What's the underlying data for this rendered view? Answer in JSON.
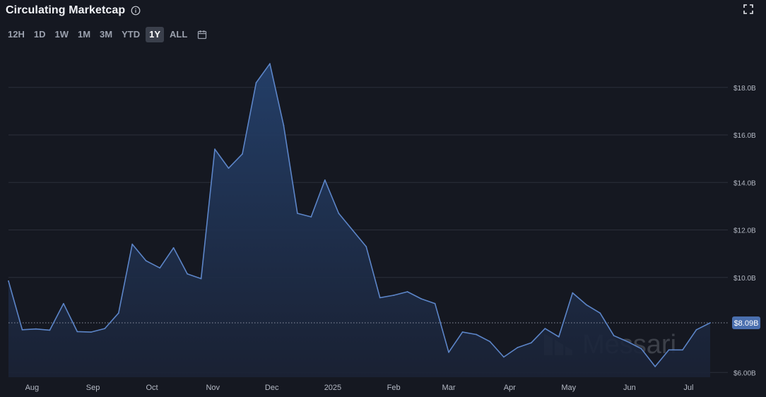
{
  "header": {
    "title": "Circulating Marketcap",
    "ranges": [
      "12H",
      "1D",
      "1W",
      "1M",
      "3M",
      "YTD",
      "1Y",
      "ALL"
    ],
    "active_range": "1Y"
  },
  "icons": {
    "info": "info-icon",
    "calendar": "calendar-icon",
    "expand": "fullscreen-icon"
  },
  "colors": {
    "background": "#151821",
    "line": "#5c85c8",
    "area_top": "#24406b",
    "area_bottom": "#1a2235",
    "grid": "#2b2f3a",
    "label_badge": "#4a6fae"
  },
  "watermark": "Messari",
  "chart_data": {
    "type": "area",
    "title": "Circulating Marketcap",
    "ylim": [
      5.8,
      19.6
    ],
    "y_ticks": [
      6,
      10,
      12,
      14,
      16,
      18
    ],
    "y_tick_labels": [
      "$6.00B",
      "$10.0B",
      "$12.0B",
      "$14.0B",
      "$16.0B",
      "$18.0B"
    ],
    "x_range": [
      "2024-07-20",
      "2025-07-21"
    ],
    "x_ticks": [
      {
        "date": "2024-08-01",
        "label": "Aug"
      },
      {
        "date": "2024-09-01",
        "label": "Sep"
      },
      {
        "date": "2024-10-01",
        "label": "Oct"
      },
      {
        "date": "2024-11-01",
        "label": "Nov"
      },
      {
        "date": "2024-12-01",
        "label": "Dec"
      },
      {
        "date": "2025-01-01",
        "label": "2025"
      },
      {
        "date": "2025-02-01",
        "label": "Feb"
      },
      {
        "date": "2025-03-01",
        "label": "Mar"
      },
      {
        "date": "2025-04-01",
        "label": "Apr"
      },
      {
        "date": "2025-05-01",
        "label": "May"
      },
      {
        "date": "2025-06-01",
        "label": "Jun"
      },
      {
        "date": "2025-07-01",
        "label": "Jul"
      }
    ],
    "series": [
      {
        "points": [
          [
            "2024-07-20",
            9.85
          ],
          [
            "2024-07-27",
            7.8
          ],
          [
            "2024-08-03",
            7.83
          ],
          [
            "2024-08-10",
            7.78
          ],
          [
            "2024-08-17",
            8.9
          ],
          [
            "2024-08-24",
            7.72
          ],
          [
            "2024-08-31",
            7.7
          ],
          [
            "2024-09-07",
            7.85
          ],
          [
            "2024-09-14",
            8.5
          ],
          [
            "2024-09-21",
            11.4
          ],
          [
            "2024-09-28",
            10.7
          ],
          [
            "2024-10-05",
            10.4
          ],
          [
            "2024-10-12",
            11.25
          ],
          [
            "2024-10-19",
            10.15
          ],
          [
            "2024-10-26",
            9.95
          ],
          [
            "2024-11-02",
            15.4
          ],
          [
            "2024-11-09",
            14.6
          ],
          [
            "2024-11-16",
            15.2
          ],
          [
            "2024-11-23",
            18.2
          ],
          [
            "2024-11-30",
            19.0
          ],
          [
            "2024-12-07",
            16.4
          ],
          [
            "2024-12-14",
            12.7
          ],
          [
            "2024-12-21",
            12.55
          ],
          [
            "2024-12-28",
            14.1
          ],
          [
            "2025-01-04",
            12.7
          ],
          [
            "2025-01-11",
            12.0
          ],
          [
            "2025-01-18",
            11.3
          ],
          [
            "2025-01-25",
            9.15
          ],
          [
            "2025-02-01",
            9.25
          ],
          [
            "2025-02-08",
            9.4
          ],
          [
            "2025-02-15",
            9.1
          ],
          [
            "2025-02-22",
            8.9
          ],
          [
            "2025-03-01",
            6.85
          ],
          [
            "2025-03-08",
            7.7
          ],
          [
            "2025-03-15",
            7.6
          ],
          [
            "2025-03-22",
            7.3
          ],
          [
            "2025-03-29",
            6.65
          ],
          [
            "2025-04-05",
            7.05
          ],
          [
            "2025-04-12",
            7.25
          ],
          [
            "2025-04-19",
            7.85
          ],
          [
            "2025-04-26",
            7.5
          ],
          [
            "2025-05-03",
            9.35
          ],
          [
            "2025-05-10",
            8.85
          ],
          [
            "2025-05-17",
            8.5
          ],
          [
            "2025-05-24",
            7.55
          ],
          [
            "2025-05-31",
            7.3
          ],
          [
            "2025-06-07",
            7.0
          ],
          [
            "2025-06-14",
            6.25
          ],
          [
            "2025-06-21",
            6.95
          ],
          [
            "2025-06-28",
            6.95
          ],
          [
            "2025-07-05",
            7.8
          ],
          [
            "2025-07-12",
            8.09
          ]
        ]
      }
    ],
    "current_value": 8.09,
    "current_label": "$8.09B",
    "grid": true
  }
}
